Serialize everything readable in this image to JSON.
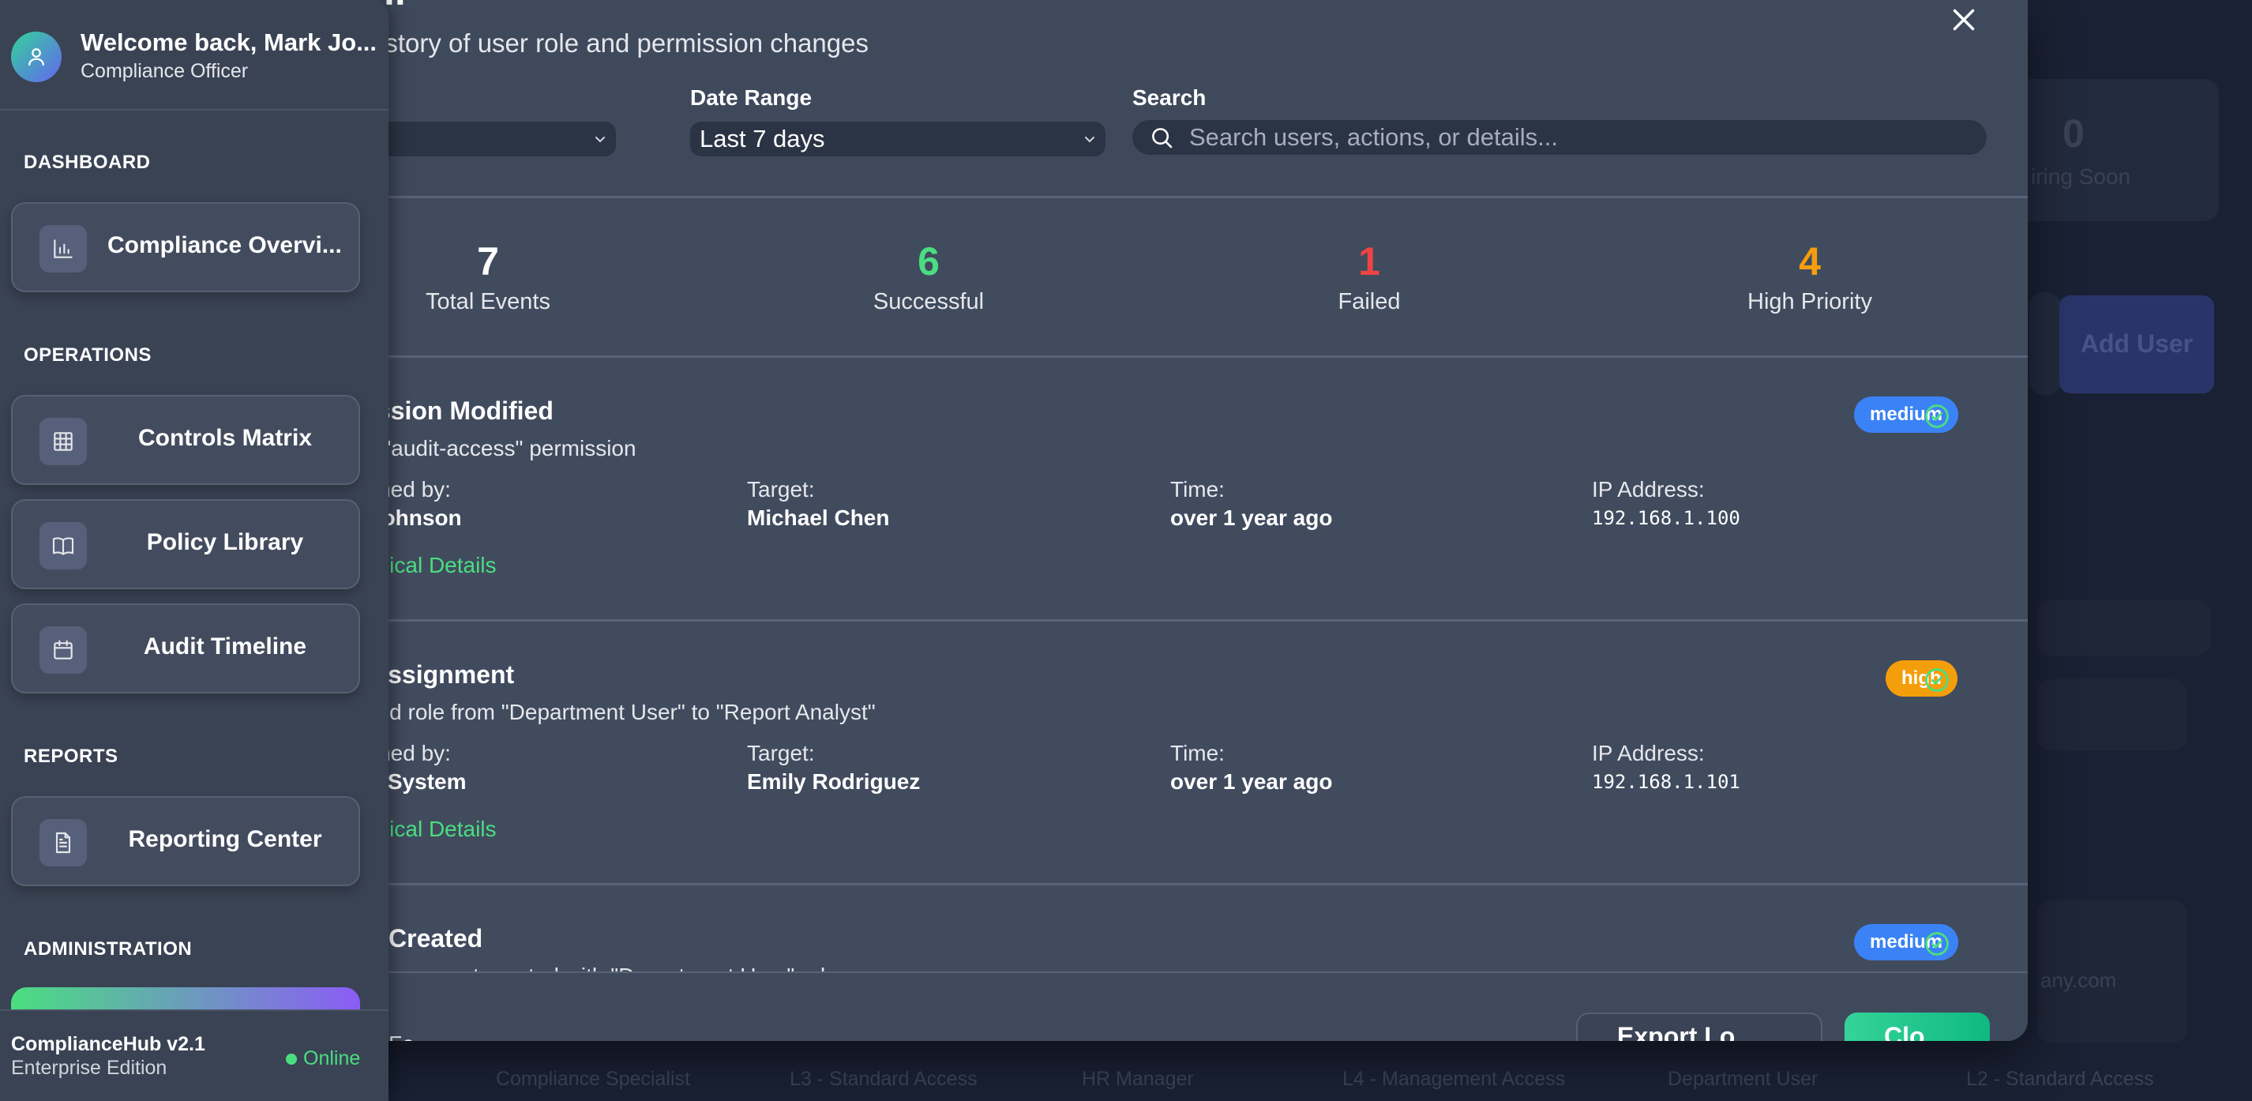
{
  "sidebar": {
    "welcome": "Welcome back, Mark Jo...",
    "role": "Compliance Officer",
    "sections": {
      "dashboard": "DASHBOARD",
      "operations": "OPERATIONS",
      "reports": "REPORTS",
      "administration": "ADMINISTRATION"
    },
    "items": [
      {
        "label": "Compliance Overvi...",
        "icon": "bar-chart-icon"
      },
      {
        "label": "Controls Matrix",
        "icon": "grid-icon"
      },
      {
        "label": "Policy Library",
        "icon": "book-icon"
      },
      {
        "label": "Audit Timeline",
        "icon": "calendar-icon"
      },
      {
        "label": "Reporting Center",
        "icon": "document-icon"
      }
    ],
    "footer": {
      "app_name": "ComplianceHub v2.1",
      "edition": "Enterprise Edition",
      "status": "Online"
    }
  },
  "modal": {
    "title": "ll",
    "subtitle": "istory of user role and permission changes",
    "filters": {
      "date_range_label": "Date Range",
      "date_range_value": "Last 7 days",
      "search_label": "Search",
      "search_placeholder": "Search users, actions, or details..."
    },
    "stats": [
      {
        "value": "7",
        "label": "Total Events",
        "color": "#ffffff"
      },
      {
        "value": "6",
        "label": "Successful",
        "color": "#4ade80"
      },
      {
        "value": "1",
        "label": "Failed",
        "color": "#ef4444"
      },
      {
        "value": "4",
        "label": "High Priority",
        "color": "#f59e0b"
      }
    ],
    "labels": {
      "performed_by": "rmed by:",
      "target": "Target:",
      "time": "Time:",
      "ip": "IP Address:",
      "details_link": "hnical Details"
    },
    "events": [
      {
        "title": "ission Modified",
        "desc": "d \"audit-access\" permission",
        "performed_by": "Johnson",
        "target": "Michael Chen",
        "time": "over 1 year ago",
        "ip": "192.168.1.100",
        "priority": "medium"
      },
      {
        "title": "Assignment",
        "desc": "ged role from \"Department User\" to \"Report Analyst\"",
        "performed_by": "n System",
        "target": "Emily Rodriguez",
        "time": "over 1 year ago",
        "ip": "192.168.1.101",
        "priority": "high"
      },
      {
        "title": "Created",
        "desc": "ser account created with \"Department User\" role",
        "priority": "medium"
      }
    ],
    "footer": {
      "left_text": "Fe...",
      "export_label": "Export Lo...",
      "close_label": "Clo..."
    }
  },
  "background": {
    "stat_value": "0",
    "stat_label": "iring Soon",
    "add_user": "Add User",
    "email_fragment": "any.com",
    "table_row": [
      "Compliance Specialist",
      "L3 - Standard Access",
      "HR Manager",
      "L4 - Management Access",
      "Department User",
      "L2 - Standard Access"
    ]
  }
}
